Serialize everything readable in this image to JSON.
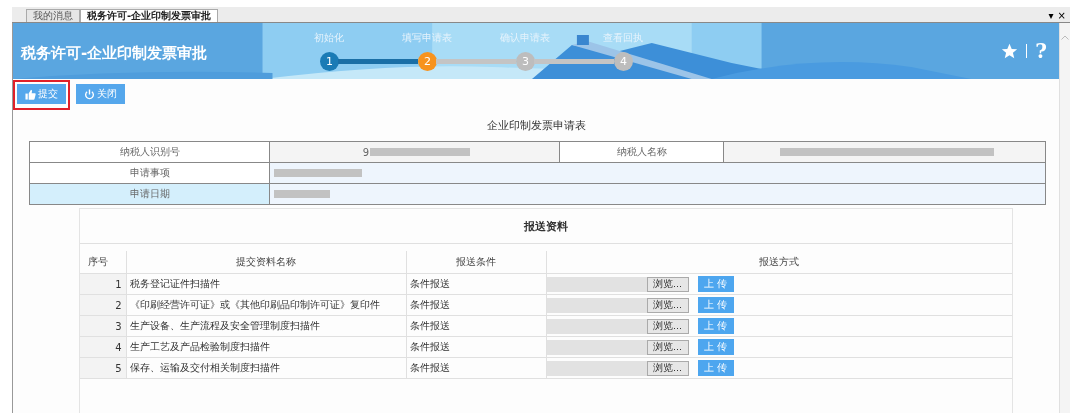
{
  "tabs": [
    {
      "label": "我的消息",
      "selected": false
    },
    {
      "label": "税务许可-企业印制发票审批",
      "selected": true
    }
  ],
  "tab_controls": {
    "menu": "▾",
    "close": "×"
  },
  "header": {
    "title": "税务许可-企业印制发票审批",
    "help": "?",
    "steps": [
      {
        "number": "1",
        "label": "初始化",
        "completed": true,
        "selected": false
      },
      {
        "number": "2",
        "label": "填写申请表",
        "completed": false,
        "selected": true
      },
      {
        "number": "3",
        "label": "确认申请表",
        "completed": false,
        "selected": false
      },
      {
        "number": "4",
        "label": "查看回执",
        "completed": false,
        "selected": false
      }
    ]
  },
  "toolbar": [
    {
      "label": "提交",
      "kind": "submit",
      "highlighted": true
    },
    {
      "label": "关闭",
      "kind": "close",
      "highlighted": false
    }
  ],
  "form_title": "企业印制发票申请表",
  "info_table": {
    "rows": [
      {
        "selected": false,
        "readonly": true,
        "fields": [
          {
            "label": "纳税人识别号",
            "value": "9",
            "redacted": true
          },
          {
            "label": "纳税人名称",
            "redacted": true
          }
        ]
      },
      {
        "selected": false,
        "readonly": false,
        "fields": [
          {
            "label": "申请事项",
            "redacted": true
          }
        ]
      },
      {
        "selected": true,
        "readonly": false,
        "fields": [
          {
            "label": "申请日期",
            "redacted": true
          }
        ]
      }
    ]
  },
  "materials": {
    "title": "报送资料",
    "columns": [
      "序号",
      "提交资料名称",
      "报送条件",
      "报送方式"
    ],
    "rows": [
      {
        "index": "1",
        "name": "税务登记证件扫描件",
        "condition": "条件报送",
        "browse": "浏览...",
        "upload": "上 传"
      },
      {
        "index": "2",
        "name": "《印刷经营许可证》或《其他印刷品印制许可证》复印件",
        "condition": "条件报送",
        "browse": "浏览...",
        "upload": "上 传"
      },
      {
        "index": "3",
        "name": "生产设备、生产流程及安全管理制度扫描件",
        "condition": "条件报送",
        "browse": "浏览...",
        "upload": "上 传"
      },
      {
        "index": "4",
        "name": "生产工艺及产品检验制度扫描件",
        "condition": "条件报送",
        "browse": "浏览...",
        "upload": "上 传"
      },
      {
        "index": "5",
        "name": "保存、运输及交付相关制度扫描件",
        "condition": "条件报送",
        "browse": "浏览...",
        "upload": "上 传"
      }
    ]
  }
}
